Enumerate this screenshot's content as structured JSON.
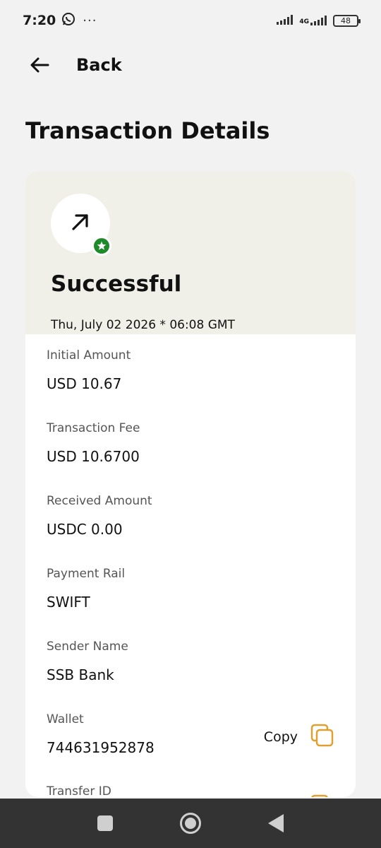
{
  "status_bar": {
    "time": "7:20",
    "overflow": "···",
    "network": "4G",
    "battery": "48"
  },
  "header": {
    "back_label": "Back"
  },
  "page": {
    "title": "Transaction Details"
  },
  "transaction": {
    "status": "Successful",
    "datetime": "Thu, July 02 2026 * 06:08 GMT",
    "status_color": "#1f8a2a",
    "fields": [
      {
        "label": "Initial Amount",
        "value": "USD 10.67"
      },
      {
        "label": "Transaction Fee",
        "value": "USD 10.6700"
      },
      {
        "label": "Received Amount",
        "value": "USDC 0.00"
      },
      {
        "label": "Payment Rail",
        "value": "SWIFT"
      },
      {
        "label": "Sender Name",
        "value": "SSB Bank"
      },
      {
        "label": "Wallet",
        "value": "744631952878"
      },
      {
        "label": "Transfer ID",
        "value": ""
      }
    ],
    "copy_label": "Copy"
  },
  "icons": {
    "back": "arrow-left-icon",
    "direction": "arrow-up-right-icon",
    "badge": "star-badge-icon",
    "copy": "copy-icon",
    "whatsapp": "whatsapp-icon"
  },
  "colors": {
    "accent_copy": "#e0a030",
    "card_top_bg": "#f1f0e8"
  }
}
